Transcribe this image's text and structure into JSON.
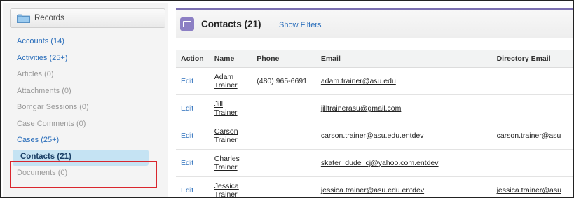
{
  "sidebar": {
    "header_label": "Records",
    "items": [
      {
        "label": "Accounts (14)",
        "link": true
      },
      {
        "label": "Activities (25+)",
        "link": true
      },
      {
        "label": "Articles (0)",
        "link": false
      },
      {
        "label": "Attachments (0)",
        "link": false
      },
      {
        "label": "Bomgar Sessions (0)",
        "link": false
      },
      {
        "label": "Case Comments (0)",
        "link": false
      },
      {
        "label": "Cases (25+)",
        "link": true
      },
      {
        "label": "Contacts (21)",
        "link": true,
        "active": true
      },
      {
        "label": "Documents (0)",
        "link": false
      }
    ]
  },
  "main": {
    "title": "Contacts (21)",
    "show_filters": "Show Filters",
    "columns": [
      "Action",
      "Name",
      "Phone",
      "Email",
      "Directory Email"
    ],
    "rows": [
      {
        "action": "Edit",
        "first": "Adam",
        "last": "Trainer",
        "phone": "(480) 965-6691",
        "email": "adam.trainer@asu.edu",
        "directory_email": ""
      },
      {
        "action": "Edit",
        "first": "Jill",
        "last": "Trainer",
        "phone": "",
        "email": "jilltrainerasu@gmail.com",
        "directory_email": ""
      },
      {
        "action": "Edit",
        "first": "Carson",
        "last": "Trainer",
        "phone": "",
        "email": "carson.trainer@asu.edu.entdev",
        "directory_email": "carson.trainer@asu"
      },
      {
        "action": "Edit",
        "first": "Charles",
        "last": "Trainer",
        "phone": "",
        "email": "skater_dude_cj@yahoo.com.entdev",
        "directory_email": ""
      },
      {
        "action": "Edit",
        "first": "Jessica",
        "last": "Trainer",
        "phone": "",
        "email": "jessica.trainer@asu.edu.entdev",
        "directory_email": "jessica.trainer@asu"
      }
    ]
  },
  "colors": {
    "link": "#2a6ebb",
    "active_bg": "#c5e3f3",
    "highlight_border": "#d9262d",
    "contacts_accent": "#7b6fb0"
  },
  "icons": {
    "records": "folder-icon",
    "contacts": "contacts-card-icon"
  }
}
